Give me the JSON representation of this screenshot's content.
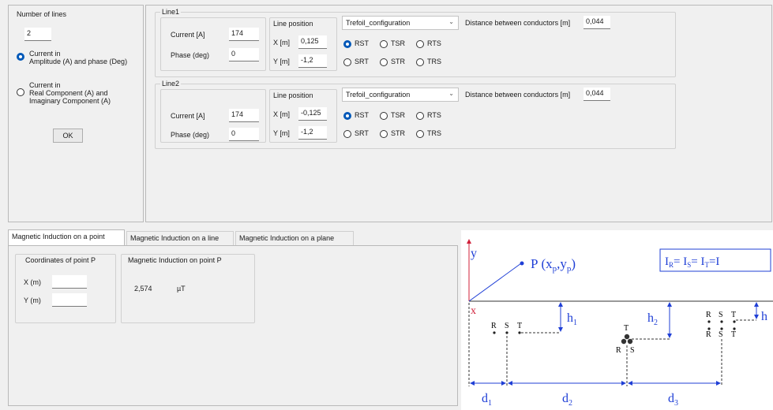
{
  "left_panel": {
    "number_of_lines_label": "Number of lines",
    "number_of_lines_value": "2",
    "option_amp_phase": {
      "line1": "Current in",
      "line2": "Amplitude (A) and phase (Deg)"
    },
    "option_real_imag": {
      "line1": "Current in",
      "line2": "Real Component (A) and",
      "line3": "Imaginary Component (A)"
    },
    "selected_option": "amplitude-phase",
    "ok_label": "OK"
  },
  "lines": [
    {
      "title": "Line1",
      "current_label": "Current [A]",
      "current_value": "174",
      "phase_label": "Phase (deg)",
      "phase_value": "0",
      "position_title": "Line position",
      "x_label": "X [m]",
      "x_value": "0,125",
      "y_label": "Y [m]",
      "y_value": "-1,2",
      "configuration": "Trefoil_configuration",
      "phase_orders_row1": [
        "RST",
        "TSR",
        "RTS"
      ],
      "phase_orders_row2": [
        "SRT",
        "STR",
        "TRS"
      ],
      "selected_order": "RST",
      "distance_label": "Distance between conductors [m]",
      "distance_value": "0,044"
    },
    {
      "title": "Line2",
      "current_label": "Current [A]",
      "current_value": "174",
      "phase_label": "Phase (deg)",
      "phase_value": "0",
      "position_title": "Line position",
      "x_label": "X [m]",
      "x_value": "-0,125",
      "y_label": "Y [m]",
      "y_value": "-1,2",
      "configuration": "Trefoil_configuration",
      "phase_orders_row1": [
        "RST",
        "TSR",
        "RTS"
      ],
      "phase_orders_row2": [
        "SRT",
        "STR",
        "TRS"
      ],
      "selected_order": "RST",
      "distance_label": "Distance between conductors [m]",
      "distance_value": "0,044"
    }
  ],
  "tabs": [
    {
      "label": "Magnetic Induction on a point",
      "active": true
    },
    {
      "label": "Magnetic Induction on a line",
      "active": false
    },
    {
      "label": "Magnetic Induction on a plane",
      "active": false
    }
  ],
  "point_tab": {
    "coords_title": "Coordinates of point P",
    "x_label": "X (m)",
    "x_value": "",
    "y_label": "Y (m)",
    "y_value": "",
    "result_title": "Magnetic Induction on point P",
    "result_value": "2,574",
    "result_unit": "µT"
  },
  "diagram": {
    "axis_y": "y",
    "axis_x": "x",
    "point_label": "P",
    "point_coords": "(x",
    "point_sub_p": "p",
    "point_sep": ",y",
    "point_close": ")",
    "equation": "I",
    "eq_r": "R",
    "eq_eq1": "= I",
    "eq_s": "S",
    "eq_eq2": "= I",
    "eq_t": "T",
    "eq_end": "=I",
    "h_label": "h",
    "d_label": "d",
    "sub1": "1",
    "sub2": "2",
    "sub3": "3",
    "phase_r": "R",
    "phase_s": "S",
    "phase_t": "T",
    "accent_color": "#1f3fd6",
    "axis_color": "#d0203a"
  }
}
